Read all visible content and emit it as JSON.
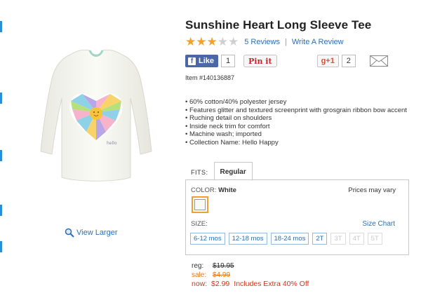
{
  "product": {
    "title": "Sunshine Heart Long Sleeve Tee",
    "rating": 3,
    "rating_max": 5,
    "reviews_link": "5 Reviews",
    "write_review_link": "Write A Review",
    "item_number": "Item #140136887",
    "view_larger": "View Larger",
    "features": [
      "60% cotton/40% polyester jersey",
      "Features glitter and textured screenprint with grosgrain ribbon bow accent",
      "Ruching detail on shoulders",
      "Inside neck trim for comfort",
      "Machine wash; imported",
      "Collection Name: Hello Happy"
    ]
  },
  "social": {
    "like_label": "Like",
    "like_count": "1",
    "pinit_label": "Pin it",
    "gplus_label": "g+1",
    "gplus_count": "2"
  },
  "fits": {
    "label": "FITS:",
    "selected": "Regular"
  },
  "options": {
    "color_label": "COLOR:",
    "color_value": "White",
    "prices_vary": "Prices may vary",
    "size_label": "SIZE:",
    "size_chart": "Size Chart",
    "sizes": [
      {
        "label": "6-12 mos",
        "available": true
      },
      {
        "label": "12-18 mos",
        "available": true
      },
      {
        "label": "18-24 mos",
        "available": true
      },
      {
        "label": "2T",
        "available": true
      },
      {
        "label": "3T",
        "available": false
      },
      {
        "label": "4T",
        "available": false
      },
      {
        "label": "5T",
        "available": false
      }
    ]
  },
  "pricing": {
    "reg_label": "reg:",
    "reg_price": "$19.95",
    "sale_label": "sale:",
    "sale_price": "$4.99",
    "now_label": "now:",
    "now_price": "$2.99",
    "now_note": "Includes Extra 40% Off"
  },
  "colors": {
    "link": "#2a6fb6",
    "star": "#f3a12b",
    "facebook": "#4a67a8",
    "sale": "#e07a1f",
    "now": "#d2361c",
    "swatch_border": "#f0a030"
  }
}
